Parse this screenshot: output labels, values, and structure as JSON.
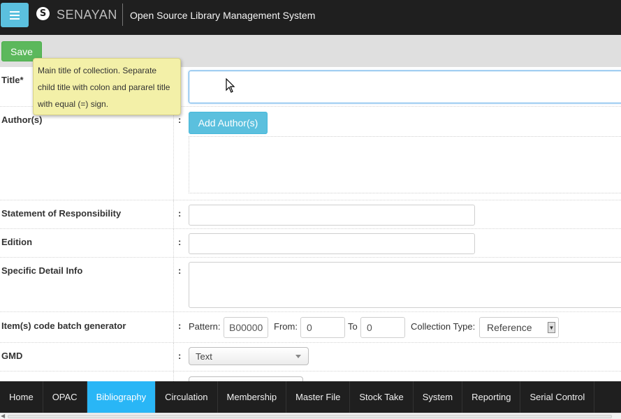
{
  "header": {
    "brand": "SENAYAN",
    "logo_letter": "S",
    "app_title": "Open Source Library Management System"
  },
  "toolbar": {
    "save_label": "Save"
  },
  "tooltip": {
    "text": "Main title of collection. Separate child title with colon and pararel title with equal (=) sign."
  },
  "form": {
    "title": {
      "label": "Title*",
      "value": ""
    },
    "authors": {
      "label": "Author(s)",
      "colon": ":",
      "add_button": "Add Author(s)"
    },
    "statement": {
      "label": "Statement of Responsibility",
      "colon": ":",
      "value": ""
    },
    "edition": {
      "label": "Edition",
      "colon": ":",
      "value": ""
    },
    "specific_detail": {
      "label": "Specific Detail Info",
      "colon": ":",
      "value": ""
    },
    "batch": {
      "label": "Item(s) code batch generator",
      "colon": ":",
      "pattern_label": "Pattern:",
      "pattern_value": "B00000",
      "from_label": "From:",
      "from_value": "0",
      "to_label": "To",
      "to_value": "0",
      "collection_type_label": "Collection Type:",
      "collection_type_value": "Reference"
    },
    "gmd": {
      "label": "GMD",
      "colon": ":",
      "value": "Text"
    }
  },
  "nav": {
    "items": [
      "Home",
      "OPAC",
      "Bibliography",
      "Circulation",
      "Membership",
      "Master File",
      "Stock Take",
      "System",
      "Reporting",
      "Serial Control"
    ],
    "active": "Bibliography"
  },
  "colors": {
    "topbar": "#1f1f1f",
    "menu_button": "#5bc0de",
    "save_button": "#5cb85c",
    "active_nav": "#29b6f6",
    "tooltip": "#f3f0a8"
  }
}
